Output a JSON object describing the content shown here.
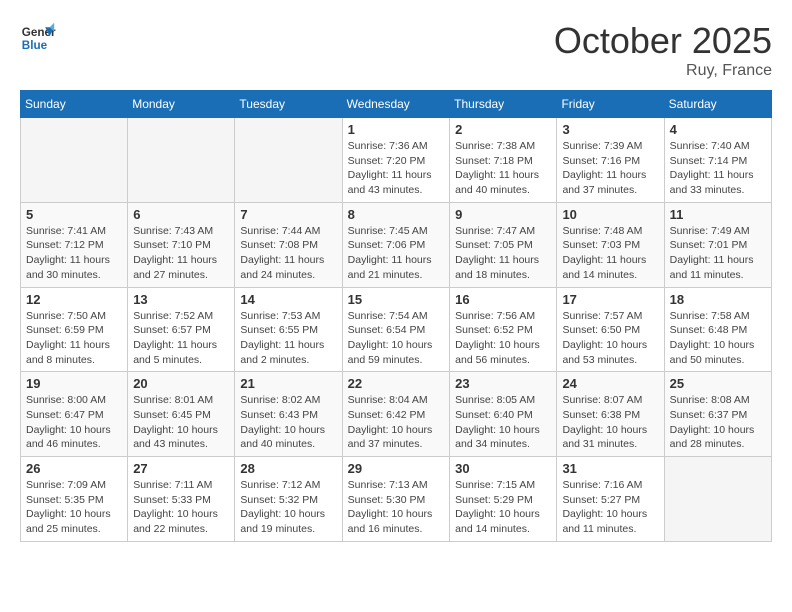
{
  "header": {
    "logo_line1": "General",
    "logo_line2": "Blue",
    "month": "October 2025",
    "location": "Ruy, France"
  },
  "days_of_week": [
    "Sunday",
    "Monday",
    "Tuesday",
    "Wednesday",
    "Thursday",
    "Friday",
    "Saturday"
  ],
  "weeks": [
    [
      {
        "day": "",
        "info": ""
      },
      {
        "day": "",
        "info": ""
      },
      {
        "day": "",
        "info": ""
      },
      {
        "day": "1",
        "info": "Sunrise: 7:36 AM\nSunset: 7:20 PM\nDaylight: 11 hours and 43 minutes."
      },
      {
        "day": "2",
        "info": "Sunrise: 7:38 AM\nSunset: 7:18 PM\nDaylight: 11 hours and 40 minutes."
      },
      {
        "day": "3",
        "info": "Sunrise: 7:39 AM\nSunset: 7:16 PM\nDaylight: 11 hours and 37 minutes."
      },
      {
        "day": "4",
        "info": "Sunrise: 7:40 AM\nSunset: 7:14 PM\nDaylight: 11 hours and 33 minutes."
      }
    ],
    [
      {
        "day": "5",
        "info": "Sunrise: 7:41 AM\nSunset: 7:12 PM\nDaylight: 11 hours and 30 minutes."
      },
      {
        "day": "6",
        "info": "Sunrise: 7:43 AM\nSunset: 7:10 PM\nDaylight: 11 hours and 27 minutes."
      },
      {
        "day": "7",
        "info": "Sunrise: 7:44 AM\nSunset: 7:08 PM\nDaylight: 11 hours and 24 minutes."
      },
      {
        "day": "8",
        "info": "Sunrise: 7:45 AM\nSunset: 7:06 PM\nDaylight: 11 hours and 21 minutes."
      },
      {
        "day": "9",
        "info": "Sunrise: 7:47 AM\nSunset: 7:05 PM\nDaylight: 11 hours and 18 minutes."
      },
      {
        "day": "10",
        "info": "Sunrise: 7:48 AM\nSunset: 7:03 PM\nDaylight: 11 hours and 14 minutes."
      },
      {
        "day": "11",
        "info": "Sunrise: 7:49 AM\nSunset: 7:01 PM\nDaylight: 11 hours and 11 minutes."
      }
    ],
    [
      {
        "day": "12",
        "info": "Sunrise: 7:50 AM\nSunset: 6:59 PM\nDaylight: 11 hours and 8 minutes."
      },
      {
        "day": "13",
        "info": "Sunrise: 7:52 AM\nSunset: 6:57 PM\nDaylight: 11 hours and 5 minutes."
      },
      {
        "day": "14",
        "info": "Sunrise: 7:53 AM\nSunset: 6:55 PM\nDaylight: 11 hours and 2 minutes."
      },
      {
        "day": "15",
        "info": "Sunrise: 7:54 AM\nSunset: 6:54 PM\nDaylight: 10 hours and 59 minutes."
      },
      {
        "day": "16",
        "info": "Sunrise: 7:56 AM\nSunset: 6:52 PM\nDaylight: 10 hours and 56 minutes."
      },
      {
        "day": "17",
        "info": "Sunrise: 7:57 AM\nSunset: 6:50 PM\nDaylight: 10 hours and 53 minutes."
      },
      {
        "day": "18",
        "info": "Sunrise: 7:58 AM\nSunset: 6:48 PM\nDaylight: 10 hours and 50 minutes."
      }
    ],
    [
      {
        "day": "19",
        "info": "Sunrise: 8:00 AM\nSunset: 6:47 PM\nDaylight: 10 hours and 46 minutes."
      },
      {
        "day": "20",
        "info": "Sunrise: 8:01 AM\nSunset: 6:45 PM\nDaylight: 10 hours and 43 minutes."
      },
      {
        "day": "21",
        "info": "Sunrise: 8:02 AM\nSunset: 6:43 PM\nDaylight: 10 hours and 40 minutes."
      },
      {
        "day": "22",
        "info": "Sunrise: 8:04 AM\nSunset: 6:42 PM\nDaylight: 10 hours and 37 minutes."
      },
      {
        "day": "23",
        "info": "Sunrise: 8:05 AM\nSunset: 6:40 PM\nDaylight: 10 hours and 34 minutes."
      },
      {
        "day": "24",
        "info": "Sunrise: 8:07 AM\nSunset: 6:38 PM\nDaylight: 10 hours and 31 minutes."
      },
      {
        "day": "25",
        "info": "Sunrise: 8:08 AM\nSunset: 6:37 PM\nDaylight: 10 hours and 28 minutes."
      }
    ],
    [
      {
        "day": "26",
        "info": "Sunrise: 7:09 AM\nSunset: 5:35 PM\nDaylight: 10 hours and 25 minutes."
      },
      {
        "day": "27",
        "info": "Sunrise: 7:11 AM\nSunset: 5:33 PM\nDaylight: 10 hours and 22 minutes."
      },
      {
        "day": "28",
        "info": "Sunrise: 7:12 AM\nSunset: 5:32 PM\nDaylight: 10 hours and 19 minutes."
      },
      {
        "day": "29",
        "info": "Sunrise: 7:13 AM\nSunset: 5:30 PM\nDaylight: 10 hours and 16 minutes."
      },
      {
        "day": "30",
        "info": "Sunrise: 7:15 AM\nSunset: 5:29 PM\nDaylight: 10 hours and 14 minutes."
      },
      {
        "day": "31",
        "info": "Sunrise: 7:16 AM\nSunset: 5:27 PM\nDaylight: 10 hours and 11 minutes."
      },
      {
        "day": "",
        "info": ""
      }
    ]
  ]
}
